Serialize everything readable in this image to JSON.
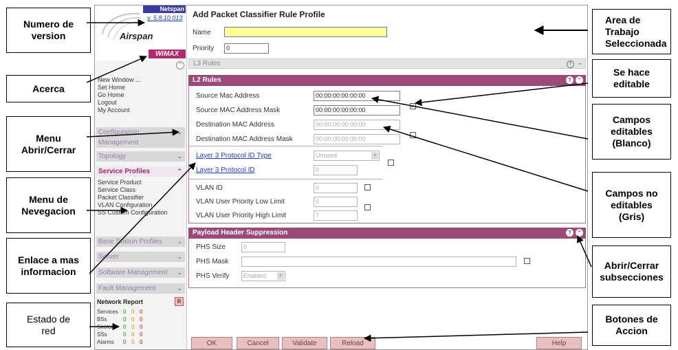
{
  "callouts": {
    "version": "Numero de\nversion",
    "about": "Acerca",
    "menu_toggle": "Menu\nAbrir/Cerrar",
    "nav_menu": "Menu de\nNevegacion",
    "more_info": "Enlace a mas\ninformacion",
    "net_status": "Estado de\nred",
    "work_area": "Area de\nTrabajo\nSeleccionada",
    "editable": "Se hace\neditable",
    "editable_fields": "Campos\neditables\n(Blanco)",
    "non_editable": "Campos no\neditables\n(Gris)",
    "toggle_sub": "Abrir/Cerrar\nsubsecciones",
    "action_buttons": "Botones de\nAccion"
  },
  "sidebar": {
    "brand_tag": "Netspan",
    "version": "v. 5.8.10.013",
    "company": "Airspan",
    "product": "WiMAX",
    "links": [
      "New Window ...",
      "Set Home",
      "Go Home",
      "Logout",
      "My Account"
    ],
    "menus": {
      "configuration": "Configuration",
      "management": "Management",
      "topology": "Topology",
      "service_profiles": "Service Profiles",
      "base_station_profiles": "Base Station Profiles",
      "server": "Server",
      "software_management": "Software Management",
      "fault_management": "Fault Management"
    },
    "service_items": [
      "Service Product",
      "Service Class",
      "Packet Classifier",
      "VLAN Configuration",
      "SS Custom Configuration"
    ],
    "network_report": {
      "title": "Network Report",
      "badge": "R",
      "rows": [
        {
          "label": "Services",
          "a": "0",
          "b": "0",
          "c": "0"
        },
        {
          "label": "BSs",
          "a": "0",
          "b": "0",
          "c": "0"
        },
        {
          "label": "Sectors",
          "a": "0",
          "b": "0",
          "c": "0"
        },
        {
          "label": "SSs",
          "a": "0",
          "b": "0",
          "c": "0"
        },
        {
          "label": "Alarms",
          "a": "0",
          "b": "0",
          "c": "0"
        }
      ]
    }
  },
  "main": {
    "title": "Add Packet Classifier Rule Profile",
    "name_label": "Name",
    "name_value": "",
    "priority_label": "Priority",
    "priority_value": "0",
    "l3_rules": "L3 Rules",
    "l2_rules": {
      "title": "L2 Rules",
      "source_mac_label": "Source Mac Address",
      "source_mac_value": "00:00:00:00:00:00",
      "source_mask_label": "Source MAC Address Mask",
      "source_mask_value": "00:00:00:00:00:00",
      "dest_mac_label": "Destination MAC Address",
      "dest_mac_value": "00:00:00:00:00:00",
      "dest_mask_label": "Destination MAC Address Mask",
      "dest_mask_value": "00:00:00:00:00:00",
      "l3_proto_type_label": "Layer 3 Protocol ID Type",
      "l3_proto_type_value": "Unused",
      "l3_proto_id_label": "Layer 3 Protocol ID",
      "l3_proto_id_value": "0",
      "vlan_id_label": "VLAN ID",
      "vlan_id_value": "0",
      "vlan_low_label": "VLAN User Priority Low Limit",
      "vlan_low_value": "0",
      "vlan_high_label": "VLAN User Priority High Limit",
      "vlan_high_value": "7"
    },
    "phs": {
      "title": "Payload Header Suppression",
      "size_label": "PHS Size",
      "size_value": "0",
      "mask_label": "PHS Mask",
      "mask_value": "",
      "verify_label": "PHS Verify",
      "verify_value": "Enabled"
    },
    "buttons": {
      "ok": "OK",
      "cancel": "Cancel",
      "validate": "Validate",
      "reload": "Reload",
      "help": "Help"
    }
  },
  "colors": {
    "accent": "#9b4a78",
    "name_field": "#ffff99",
    "button_bg": "#e8c0c0"
  }
}
